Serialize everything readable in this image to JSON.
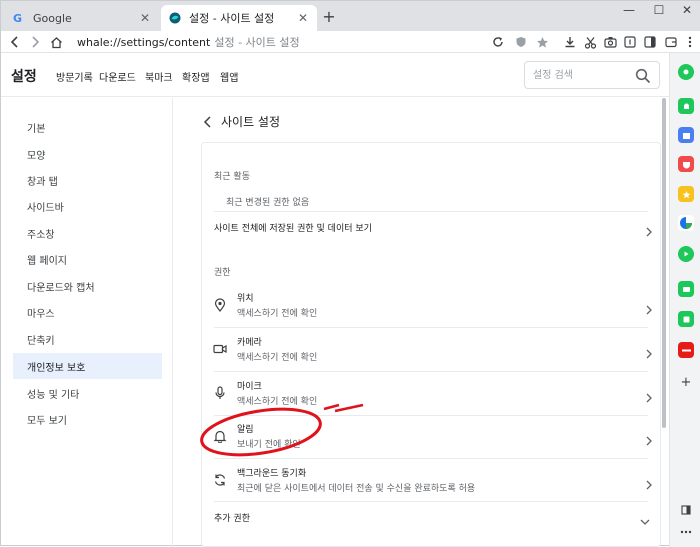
{
  "browser": {
    "tabs": [
      {
        "title": "Google",
        "active": false
      },
      {
        "title": "설정 - 사이트 설정",
        "active": true
      }
    ],
    "new_tab": "+",
    "window_controls": [
      "—",
      "☐",
      "✕"
    ],
    "address": {
      "host": "whale://settings/content",
      "page_title": "설정 - 사이트 설정"
    }
  },
  "header": {
    "logo": "설정",
    "nav": [
      "방문기록",
      "다운로드",
      "북마크",
      "확장앱",
      "웹앱"
    ],
    "search_placeholder": "설정 검색"
  },
  "sidebar": {
    "items": [
      {
        "label": "기본",
        "active": false
      },
      {
        "label": "모양",
        "active": false
      },
      {
        "label": "창과 탭",
        "active": false
      },
      {
        "label": "사이드바",
        "active": false
      },
      {
        "label": "주소창",
        "active": false
      },
      {
        "label": "웹 페이지",
        "active": false
      },
      {
        "label": "다운로드와 캡처",
        "active": false
      },
      {
        "label": "마우스",
        "active": false
      },
      {
        "label": "단축키",
        "active": false
      },
      {
        "label": "개인정보 보호",
        "active": true
      },
      {
        "label": "성능 및 기타",
        "active": false
      },
      {
        "label": "모두 보기",
        "active": false
      }
    ]
  },
  "main": {
    "title": "사이트 설정",
    "recent": {
      "label": "최근 활동",
      "empty": "최근 변경된 권한 없음",
      "view_all": "사이트 전체에 저장된 권한 및 데이터 보기"
    },
    "permissions_label": "권한",
    "permissions": [
      {
        "name": "위치",
        "desc": "액세스하기 전에 확인",
        "icon": "location-icon"
      },
      {
        "name": "카메라",
        "desc": "액세스하기 전에 확인",
        "icon": "camera-icon"
      },
      {
        "name": "마이크",
        "desc": "액세스하기 전에 확인",
        "icon": "microphone-icon"
      },
      {
        "name": "알림",
        "desc": "보내기 전에 확인",
        "icon": "bell-icon"
      },
      {
        "name": "백그라운드 동기화",
        "desc": "최근에 닫은 사이트에서 데이터 전송 및 수신을 완료하도록 허용",
        "icon": "sync-icon"
      }
    ],
    "additional": "추가 권한"
  },
  "colors": {
    "accent_annotation": "#e0121b",
    "active_sidebar_bg": "#e8f0fe"
  }
}
